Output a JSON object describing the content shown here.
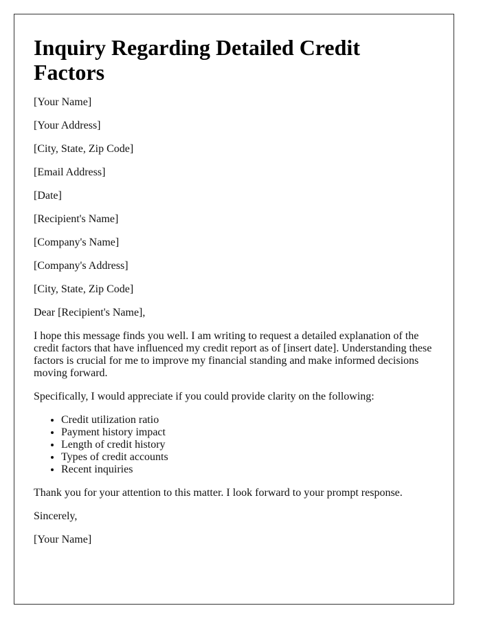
{
  "letter": {
    "title": "Inquiry Regarding Detailed Credit Factors",
    "sender": {
      "name": "[Your Name]",
      "address": "[Your Address]",
      "city_state_zip": "[City, State, Zip Code]",
      "email": "[Email Address]",
      "date": "[Date]"
    },
    "recipient": {
      "name": "[Recipient's Name]",
      "company": "[Company's Name]",
      "company_address": "[Company's Address]",
      "city_state_zip": "[City, State, Zip Code]"
    },
    "salutation": "Dear [Recipient's Name],",
    "body_paragraph_1": "I hope this message finds you well. I am writing to request a detailed explanation of the credit factors that have influenced my credit report as of [insert date]. Understanding these factors is crucial for me to improve my financial standing and make informed decisions moving forward.",
    "body_paragraph_2": "Specifically, I would appreciate if you could provide clarity on the following:",
    "factors": [
      "Credit utilization ratio",
      "Payment history impact",
      "Length of credit history",
      "Types of credit accounts",
      "Recent inquiries"
    ],
    "closing_paragraph": "Thank you for your attention to this matter. I look forward to your prompt response.",
    "sign_off": "Sincerely,",
    "signature": "[Your Name]"
  }
}
